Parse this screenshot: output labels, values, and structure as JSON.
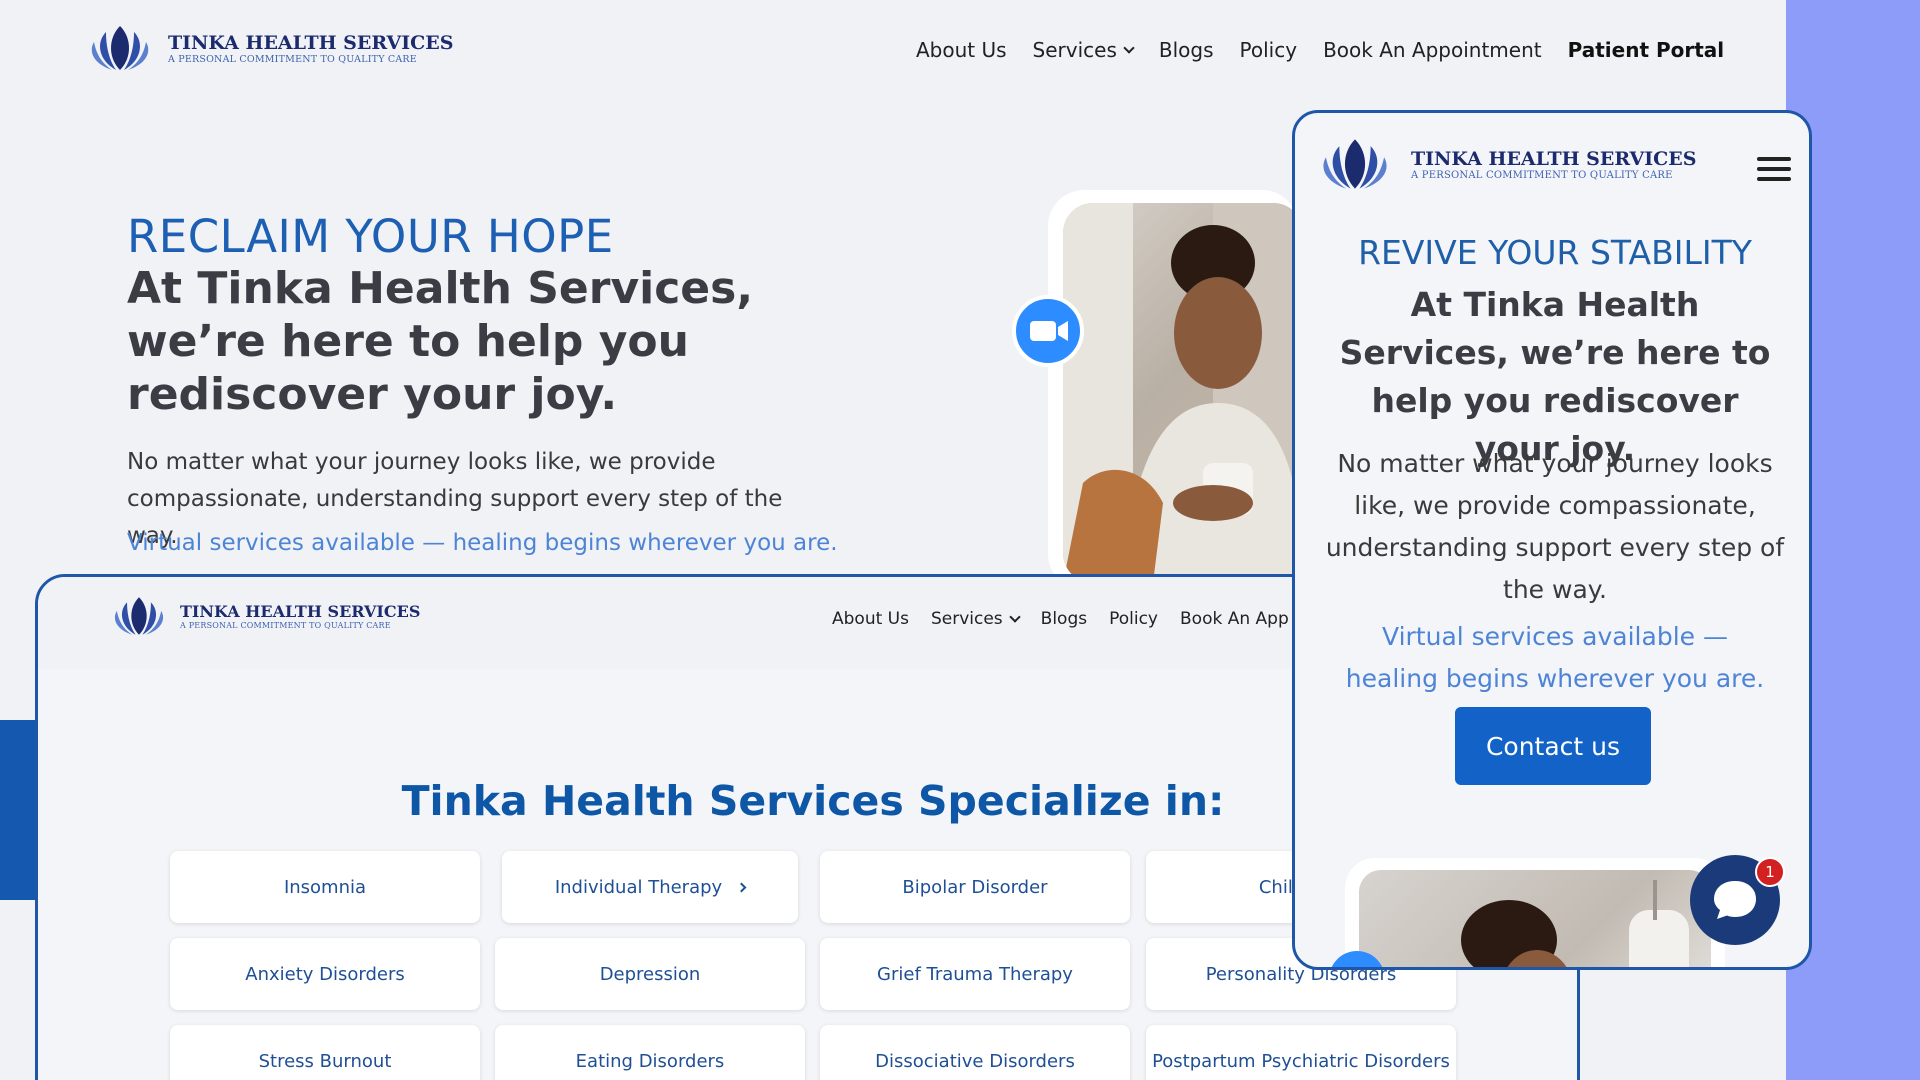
{
  "brand": {
    "name": "TINKA HEALTH SERVICES",
    "tagline": "A PERSONAL COMMITMENT TO QUALITY CARE",
    "colors": {
      "primary": "#1d5fb3",
      "navy": "#1c2a6e",
      "accent_bg": "#8e9cf9",
      "link_blue": "#4d84d6"
    }
  },
  "nav": {
    "about": "About Us",
    "services": "Services",
    "blogs": "Blogs",
    "policy": "Policy",
    "book": "Book An Appointment",
    "book_truncated": "Book An App",
    "portal": "Patient Portal"
  },
  "hero": {
    "eyebrow": "RECLAIM YOUR HOPE",
    "title": "At Tinka Health Services, we’re here to help you rediscover your joy.",
    "body": "No matter what your journey looks like, we provide compassionate, understanding support every step of the way.",
    "virtual": "Virtual services available — healing begins wherever you are.",
    "video_icon": "zoom-video-icon"
  },
  "specialties": {
    "title": "Tinka Health Services Specialize in:",
    "items": [
      "Insomnia",
      "Individual Therapy",
      "Bipolar Disorder",
      "Childrens",
      "Anxiety Disorders",
      "Depression",
      "Grief Trauma Therapy",
      "Personality Disorders",
      "Stress Burnout",
      "Eating Disorders",
      "Dissociative Disorders",
      "Postpartum Psychiatric Disorders"
    ]
  },
  "mobile": {
    "eyebrow": "REVIVE YOUR STABILITY",
    "title": "At Tinka Health Services, we’re here to help you rediscover your joy.",
    "body": "No matter what your journey looks like, we provide compassionate, understanding support every step of the way.",
    "virtual": "Virtual services available — healing begins wherever you are.",
    "contact_label": "Contact us",
    "menu_icon": "hamburger-menu-icon",
    "chat_badge": "1"
  }
}
